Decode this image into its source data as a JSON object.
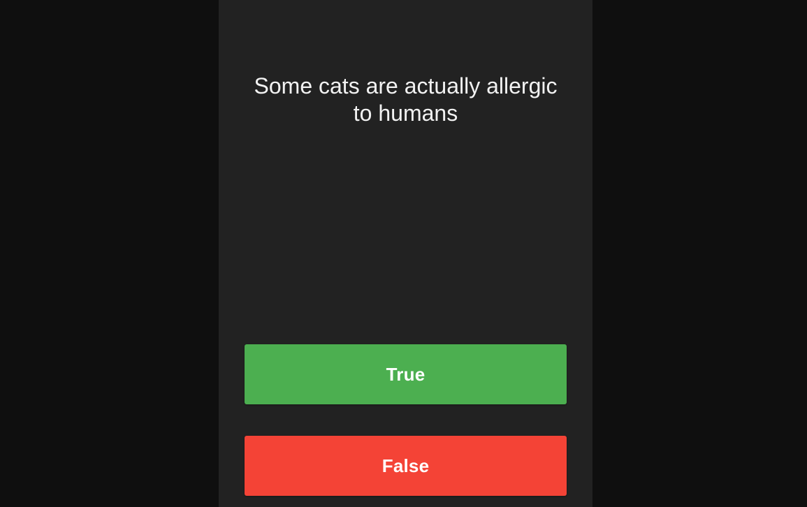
{
  "quiz": {
    "question": "Some cats are actually allergic to humans",
    "true_label": "True",
    "false_label": "False"
  },
  "colors": {
    "page_background": "#0f0f0f",
    "panel_background": "#222222",
    "question_text": "#f2f2f2",
    "true_button": "#4caf50",
    "false_button": "#f44336",
    "button_text": "#ffffff"
  }
}
